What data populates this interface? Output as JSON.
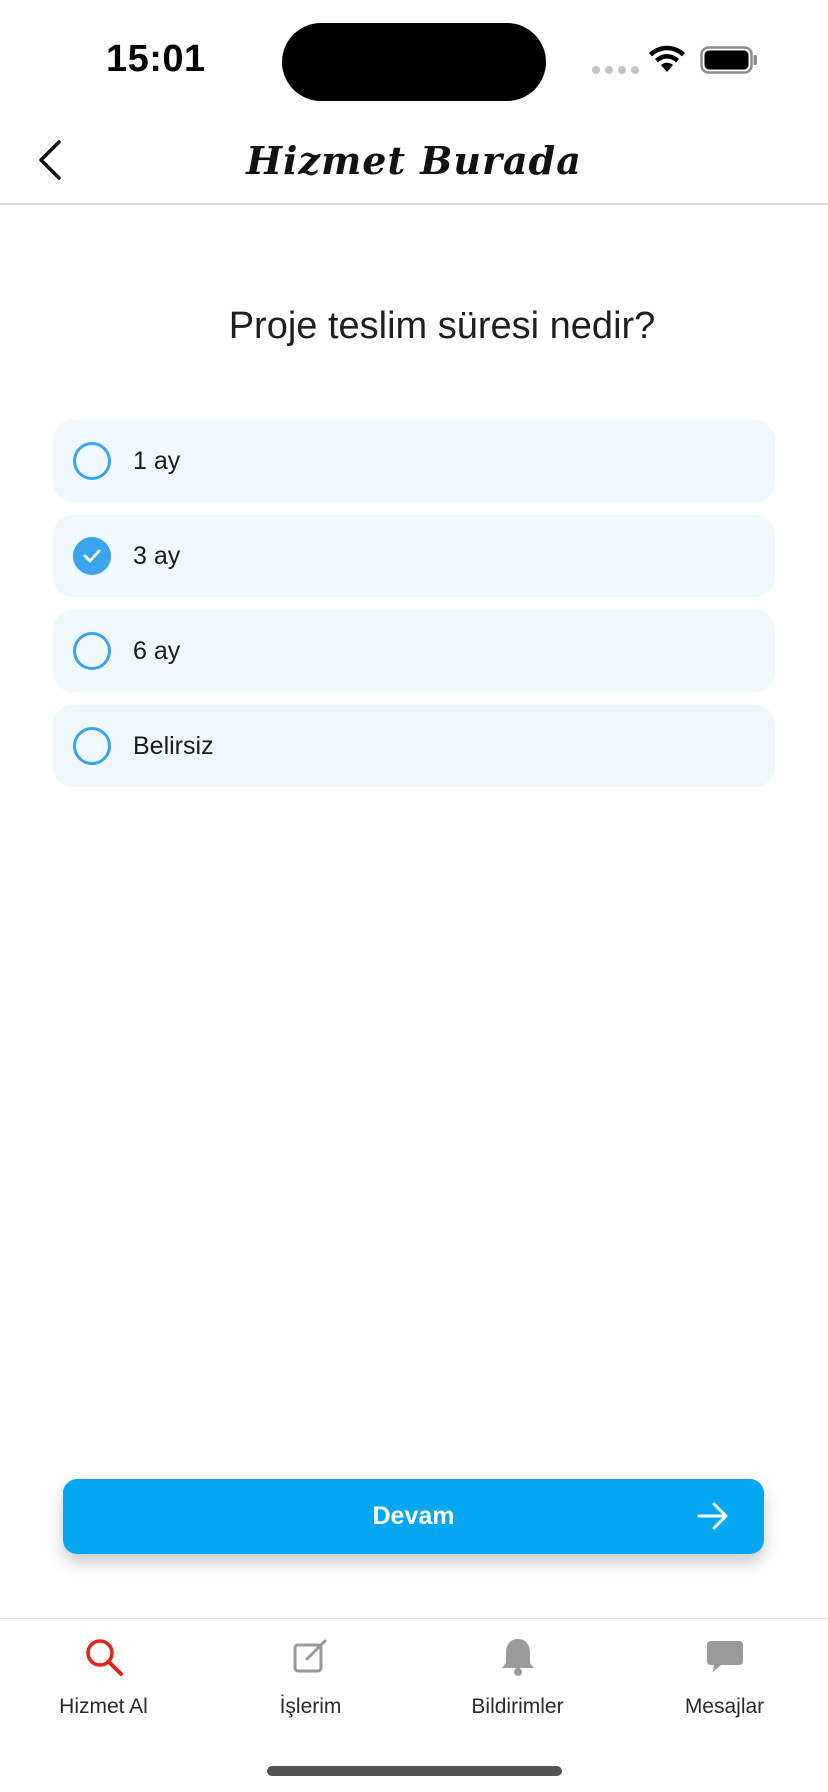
{
  "status_bar": {
    "time": "15:01"
  },
  "nav": {
    "title": "Hizmet Burada",
    "back_icon": "chevron-left-icon"
  },
  "question": "Proje teslim süresi nedir?",
  "options": [
    {
      "label": "1 ay",
      "selected": false
    },
    {
      "label": "3 ay",
      "selected": true
    },
    {
      "label": "6 ay",
      "selected": false
    },
    {
      "label": "Belirsiz",
      "selected": false
    }
  ],
  "continue_button": {
    "label": "Devam",
    "icon": "arrow-right-icon"
  },
  "tabs": [
    {
      "label": "Hizmet Al",
      "icon": "search-icon",
      "active": true
    },
    {
      "label": "İşlerim",
      "icon": "edit-icon",
      "active": false
    },
    {
      "label": "Bildirimler",
      "icon": "bell-icon",
      "active": false
    },
    {
      "label": "Mesajlar",
      "icon": "chat-icon",
      "active": false
    }
  ],
  "colors": {
    "accent": "#05a8f0",
    "radio": "#3aa5ec",
    "option_bg": "#eef8fd",
    "active_tab": "#e8201a",
    "inactive_tab": "#9a9a9a"
  }
}
